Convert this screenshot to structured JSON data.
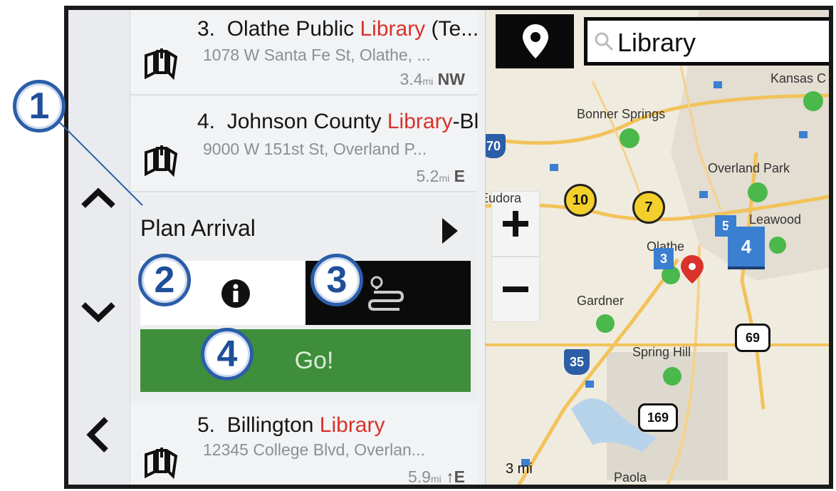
{
  "results": [
    {
      "number": "3.",
      "name_pre": "Olathe Public ",
      "name_hl": "Library",
      "name_post": " (Te...",
      "address": "1078 W Santa Fe St, Olathe, ...",
      "distance": "3.4",
      "unit": "mi",
      "direction": "NW"
    },
    {
      "number": "4.",
      "name_pre": "Johnson County ",
      "name_hl": "Library",
      "name_post": "-Bl",
      "address": "9000 W 151st St, Overland P...",
      "distance": "5.2",
      "unit": "mi",
      "direction": "E"
    },
    {
      "number": "5.",
      "name_pre": "Billington ",
      "name_hl": "Library",
      "name_post": "",
      "address": "12345 College Blvd, Overlan...",
      "distance": "5.9",
      "unit": "mi",
      "direction": "↑E"
    }
  ],
  "plan": {
    "label": "Plan Arrival",
    "go_label": "Go!"
  },
  "search": {
    "value": "Library"
  },
  "map": {
    "scale": "3 mi",
    "labels": [
      "Bonner Springs",
      "Kansas C",
      "Overland Park",
      "Leawood",
      "Eudora",
      "Olathe",
      "Gardner",
      "Spring Hill",
      "Paola"
    ],
    "highways": [
      "70",
      "10",
      "7",
      "35",
      "69",
      "169"
    ],
    "markers": [
      "5",
      "3",
      "4"
    ]
  },
  "callouts": [
    "1",
    "2",
    "3",
    "4"
  ],
  "colors": {
    "highlight": "#d8322a",
    "go": "#3f8e3c",
    "callout": "#2c5ea8"
  }
}
